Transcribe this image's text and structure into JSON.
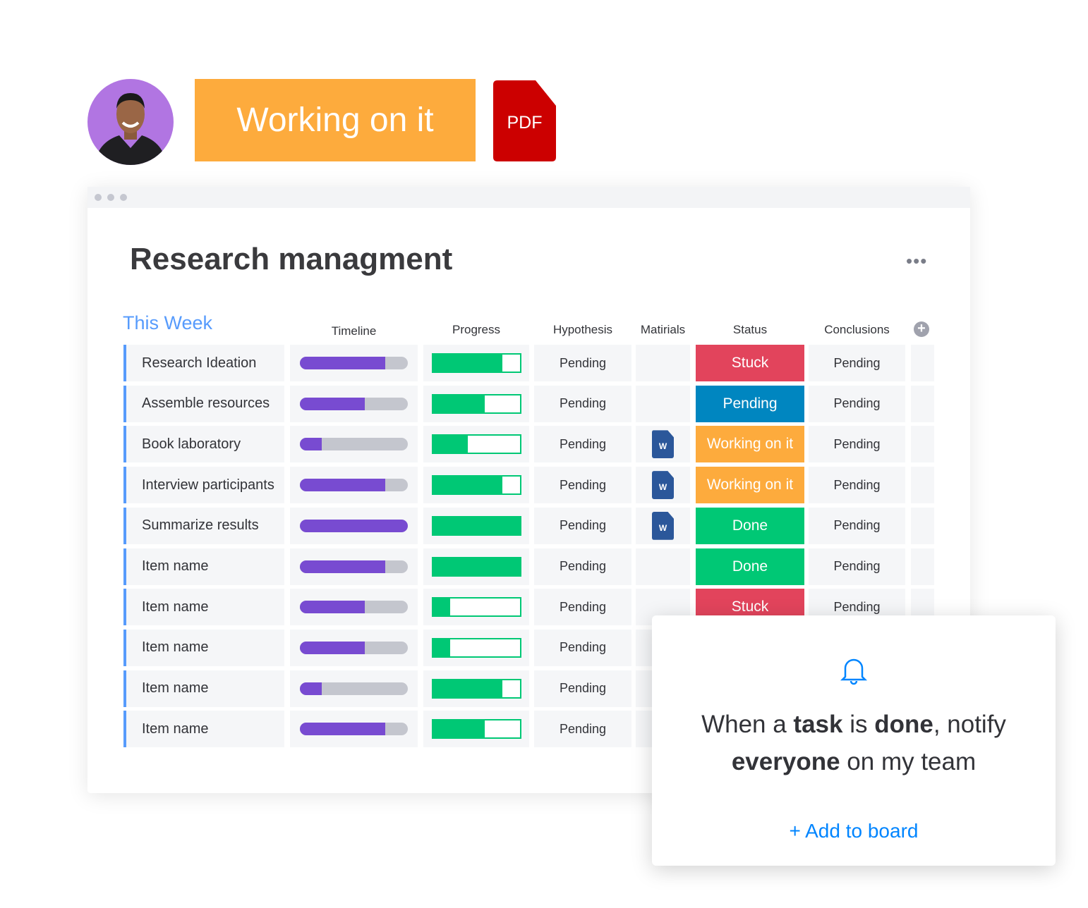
{
  "header_badge": {
    "label": "Working on it",
    "color": "#fdab3d"
  },
  "pdf": {
    "label": "PDF",
    "color": "#cc0000"
  },
  "board": {
    "title": "Research managment",
    "more": "•••",
    "group": "This Week",
    "columns": {
      "timeline": "Timeline",
      "progress": "Progress",
      "hypothesis": "Hypothesis",
      "materials": "Matirials",
      "status": "Status",
      "conclusions": "Conclusions"
    },
    "rows": [
      {
        "name": "Research Ideation",
        "timeline": 0.79,
        "progress": 0.8,
        "hypothesis": "Pending",
        "file": false,
        "status": "Stuck",
        "status_color": "#e2445c",
        "conclusion": "Pending"
      },
      {
        "name": "Assemble resources",
        "timeline": 0.6,
        "progress": 0.6,
        "hypothesis": "Pending",
        "file": false,
        "status": "Pending",
        "status_color": "#0086c0",
        "conclusion": "Pending"
      },
      {
        "name": "Book laboratory",
        "timeline": 0.2,
        "progress": 0.4,
        "hypothesis": "Pending",
        "file": true,
        "status": "Working on it",
        "status_color": "#fdab3d",
        "conclusion": "Pending"
      },
      {
        "name": "Interview participants",
        "timeline": 0.79,
        "progress": 0.8,
        "hypothesis": "Pending",
        "file": true,
        "status": "Working on it",
        "status_color": "#fdab3d",
        "conclusion": "Pending"
      },
      {
        "name": "Summarize results",
        "timeline": 1.0,
        "progress": 1.0,
        "hypothesis": "Pending",
        "file": true,
        "status": "Done",
        "status_color": "#00c875",
        "conclusion": "Pending"
      },
      {
        "name": "Item name",
        "timeline": 0.79,
        "progress": 1.0,
        "hypothesis": "Pending",
        "file": false,
        "status": "Done",
        "status_color": "#00c875",
        "conclusion": "Pending"
      },
      {
        "name": "Item name",
        "timeline": 0.6,
        "progress": 0.2,
        "hypothesis": "Pending",
        "file": false,
        "status": "Stuck",
        "status_color": "#e2445c",
        "conclusion": "Pending"
      },
      {
        "name": "Item name",
        "timeline": 0.6,
        "progress": 0.2,
        "hypothesis": "Pending",
        "file": false,
        "status": "",
        "status_color": "",
        "conclusion": ""
      },
      {
        "name": "Item name",
        "timeline": 0.2,
        "progress": 0.8,
        "hypothesis": "Pending",
        "file": false,
        "status": "",
        "status_color": "",
        "conclusion": ""
      },
      {
        "name": "Item name",
        "timeline": 0.79,
        "progress": 0.6,
        "hypothesis": "Pending",
        "file": false,
        "status": "",
        "status_color": "",
        "conclusion": ""
      }
    ],
    "file_icon_label": "W"
  },
  "notification": {
    "p1": "When a ",
    "b1": "task",
    "p2": " is ",
    "b2": "done",
    "p3": ", notify",
    "b3": "everyone",
    "p4": " on my team",
    "action": "+ Add to board"
  }
}
